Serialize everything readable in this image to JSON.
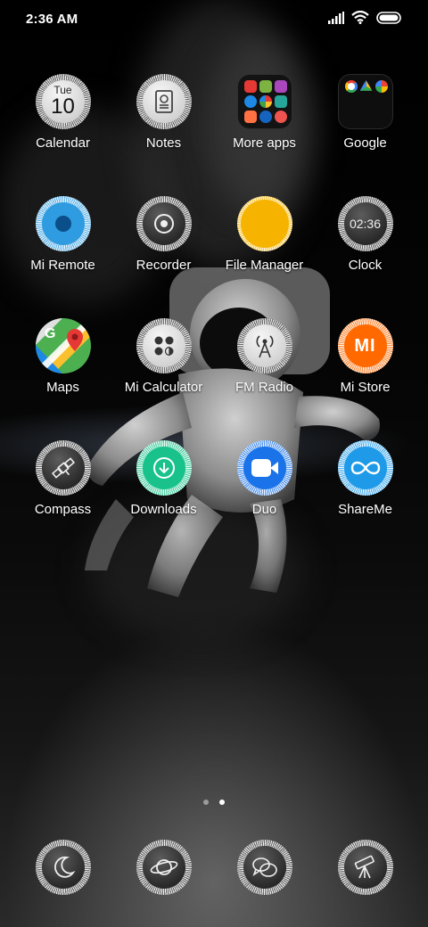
{
  "status_bar": {
    "time": "2:36 AM"
  },
  "apps": [
    {
      "label": "Calendar",
      "icon": "calendar-icon",
      "day": "Tue",
      "date": "10"
    },
    {
      "label": "Notes",
      "icon": "notes-icon"
    },
    {
      "label": "More apps",
      "icon": "folder-icon"
    },
    {
      "label": "Google",
      "icon": "folder-icon"
    },
    {
      "label": "Mi Remote",
      "icon": "remote-icon"
    },
    {
      "label": "Recorder",
      "icon": "recorder-icon"
    },
    {
      "label": "File Manager",
      "icon": "file-manager-icon"
    },
    {
      "label": "Clock",
      "icon": "clock-icon",
      "time": "02:36"
    },
    {
      "label": "Maps",
      "icon": "maps-icon"
    },
    {
      "label": "Mi Calculator",
      "icon": "calculator-icon"
    },
    {
      "label": "FM Radio",
      "icon": "radio-icon"
    },
    {
      "label": "Mi Store",
      "icon": "mi-store-icon",
      "logo": "MI"
    },
    {
      "label": "Compass",
      "icon": "satellite-icon"
    },
    {
      "label": "Downloads",
      "icon": "download-icon"
    },
    {
      "label": "Duo",
      "icon": "video-camera-icon"
    },
    {
      "label": "ShareMe",
      "icon": "infinity-icon"
    }
  ],
  "dock": [
    {
      "icon": "moon-icon"
    },
    {
      "icon": "planet-icon"
    },
    {
      "icon": "chat-bubbles-icon"
    },
    {
      "icon": "telescope-icon"
    }
  ],
  "pager": {
    "pages": 2,
    "current": 2
  },
  "colors": {
    "remote_blue": "#2f9be0",
    "file_manager_yellow": "#f6b400",
    "mi_orange": "#ff6900",
    "downloads_green": "#19c28a",
    "duo_blue": "#1a73e8",
    "shareme_blue": "#1e9ae8"
  }
}
